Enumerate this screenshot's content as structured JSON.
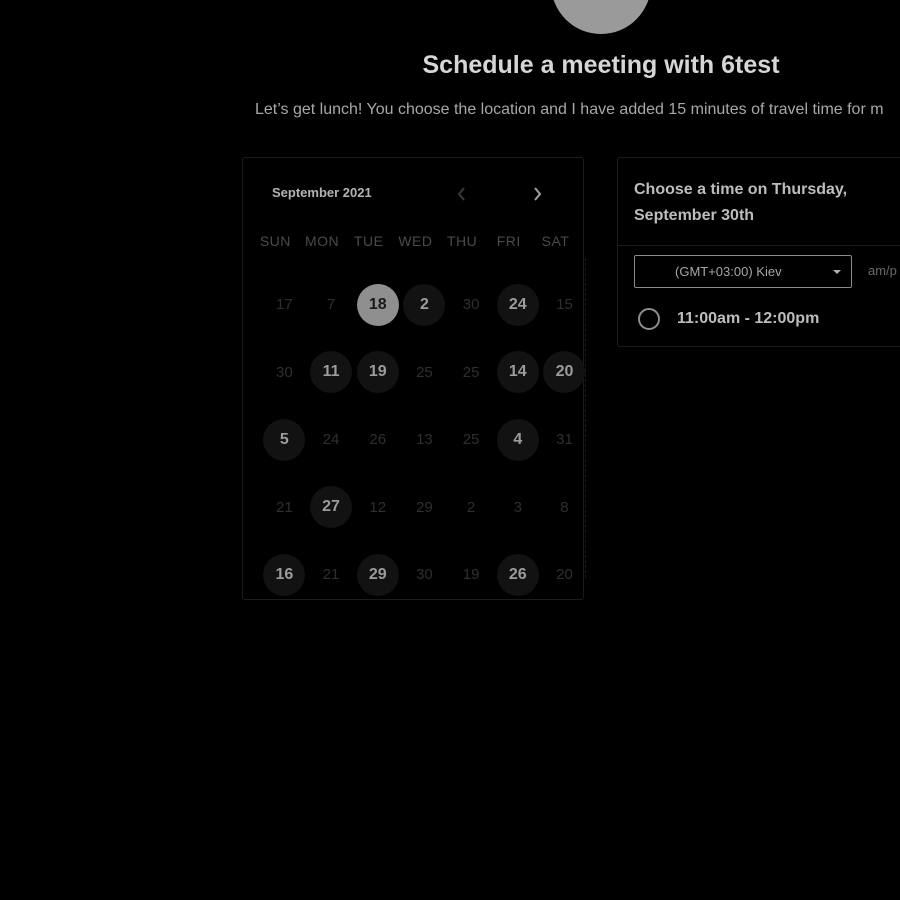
{
  "header": {
    "title": "Schedule a meeting with 6test",
    "subtitle": "Let’s get lunch! You choose the location and I have added 15 minutes of travel time for m"
  },
  "calendar": {
    "month_label": "September 2021",
    "prev_icon": "chevron-left-icon",
    "next_icon": "chevron-right-icon",
    "weekdays": [
      "SUN",
      "MON",
      "TUE",
      "WED",
      "THU",
      "FRI",
      "SAT"
    ],
    "weeks": [
      [
        {
          "label": "17",
          "state": "inactive"
        },
        {
          "label": "7",
          "state": "inactive"
        },
        {
          "label": "18",
          "state": "selected"
        },
        {
          "label": "2",
          "state": "available"
        },
        {
          "label": "30",
          "state": "inactive"
        },
        {
          "label": "24",
          "state": "available"
        },
        {
          "label": "15",
          "state": "inactive"
        }
      ],
      [
        {
          "label": "30",
          "state": "inactive"
        },
        {
          "label": "11",
          "state": "available"
        },
        {
          "label": "19",
          "state": "available"
        },
        {
          "label": "25",
          "state": "inactive"
        },
        {
          "label": "25",
          "state": "inactive"
        },
        {
          "label": "14",
          "state": "available"
        },
        {
          "label": "20",
          "state": "available"
        }
      ],
      [
        {
          "label": "5",
          "state": "available"
        },
        {
          "label": "24",
          "state": "inactive"
        },
        {
          "label": "26",
          "state": "inactive"
        },
        {
          "label": "13",
          "state": "inactive"
        },
        {
          "label": "25",
          "state": "inactive"
        },
        {
          "label": "4",
          "state": "available"
        },
        {
          "label": "31",
          "state": "inactive"
        }
      ],
      [
        {
          "label": "21",
          "state": "inactive"
        },
        {
          "label": "27",
          "state": "available"
        },
        {
          "label": "12",
          "state": "inactive"
        },
        {
          "label": "29",
          "state": "inactive"
        },
        {
          "label": "2",
          "state": "inactive"
        },
        {
          "label": "3",
          "state": "inactive"
        },
        {
          "label": "8",
          "state": "inactive"
        }
      ],
      [
        {
          "label": "16",
          "state": "available"
        },
        {
          "label": "21",
          "state": "inactive"
        },
        {
          "label": "29",
          "state": "available"
        },
        {
          "label": "30",
          "state": "inactive"
        },
        {
          "label": "19",
          "state": "inactive"
        },
        {
          "label": "26",
          "state": "available"
        },
        {
          "label": "20",
          "state": "inactive"
        }
      ]
    ]
  },
  "time_panel": {
    "heading": "Choose a time on Thursday, September 30th",
    "timezone": "(GMT+03:00) Kiev",
    "format_toggle": "am/p",
    "slots": [
      {
        "label": "11:00am - 12:00pm",
        "selected": false
      }
    ]
  },
  "colors": {
    "background": "#000000",
    "selected_day": "#8f8f8f",
    "available_day": "#121212",
    "avatar": "#9a9a9a"
  }
}
